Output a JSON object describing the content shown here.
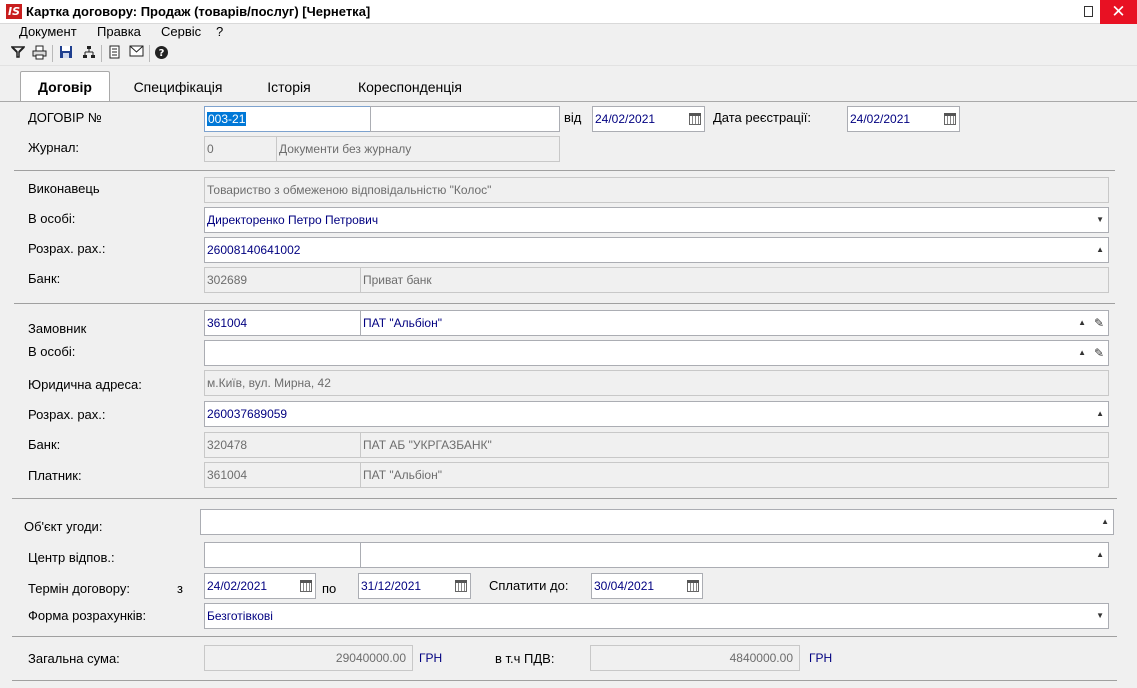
{
  "window": {
    "title": "Картка договору: Продаж (товарів/послуг) [Чернетка]",
    "logo": "IS"
  },
  "menu": [
    "Документ",
    "Правка",
    "Сервіс",
    "?"
  ],
  "toolbar": [
    "filter-icon",
    "print-icon",
    "save-icon",
    "hierarchy-icon",
    "document-icon",
    "mail-icon",
    "help-icon"
  ],
  "tabs": [
    "Договір",
    "Специфікація",
    "Історія",
    "Кореспонденція"
  ],
  "contract": {
    "number_label": "ДОГОВІР №",
    "number": "003-21",
    "extra": "",
    "from_label": "від",
    "date": "24/02/2021",
    "reg_label": "Дата реєстрації:",
    "reg_date": "24/02/2021",
    "journal_label": "Журнал:",
    "journal_code": "0",
    "journal_name": "Документи без журналу"
  },
  "executor": {
    "label": "Виконавець",
    "value": "Товариство з обмеженою відповідальністю \"Колос\"",
    "person_label": "В особі:",
    "person": "Директоренко Петро Петрович",
    "account_label": "Розрах. рах.:",
    "account": "26008140641002",
    "bank_label": "Банк:",
    "bank_code": "302689",
    "bank_name": "Приват банк"
  },
  "customer": {
    "label": "Замовник",
    "code": "361004",
    "name": "ПАТ \"Альбіон\"",
    "person_label": "В особі:",
    "person": "",
    "address_label": "Юридична адреса:",
    "address": "м.Київ, вул. Мирна, 42",
    "account_label": "Розрах. рах.:",
    "account": "260037689059",
    "bank_label": "Банк:",
    "bank_code": "320478",
    "bank_name": "ПАТ АБ \"УКРГАЗБАНК\"",
    "payer_label": "Платник:",
    "payer_code": "361004",
    "payer_name": "ПАТ \"Альбіон\""
  },
  "terms": {
    "object_label": "Об'єкт угоди:",
    "object": "",
    "center_label": "Центр відпов.:",
    "center_code": "",
    "center_name": "",
    "term_label": "Термін договору:",
    "from_label": "з",
    "start": "24/02/2021",
    "to_label": "по",
    "end": "31/12/2021",
    "pay_label": "Сплатити до:",
    "pay_date": "30/04/2021",
    "form_label": "Форма розрахунків:",
    "form": "Безготівкові"
  },
  "totals": {
    "sum_label": "Загальна сума:",
    "sum": "29040000.00",
    "sum_currency": "ГРН",
    "vat_label": "в т.ч ПДВ:",
    "vat": "4840000.00",
    "vat_currency": "ГРН"
  }
}
